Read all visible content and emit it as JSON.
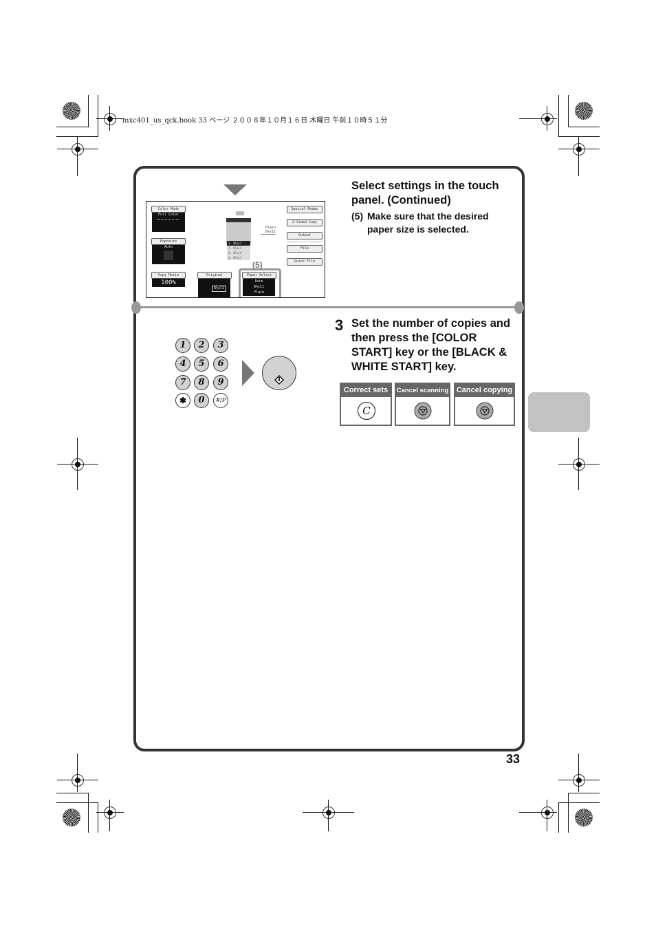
{
  "print_header": "mxc401_us_qck.book  33 ページ  ２００８年１０月１６日  木曜日  午前１０時５１分",
  "step_continued": {
    "heading": "Select settings in the touch panel. (Continued)",
    "substep_number": "(5)",
    "substep_text": "Make sure that the desired paper size is selected."
  },
  "touch_panel": {
    "color_mode": {
      "label": "Color Mode",
      "value": "Full Color"
    },
    "exposure": {
      "label": "Exposure",
      "value": "Auto"
    },
    "copy_ratio": {
      "label": "Copy Ratio",
      "value": "100%"
    },
    "original": {
      "label": "Original",
      "value": "8½x11"
    },
    "paper_select": {
      "label": "Paper Select",
      "values": [
        "Auto",
        "8½x11",
        "Plain"
      ],
      "callout": "(5)"
    },
    "output_tray": {
      "type": "Plain",
      "size": "8½x11"
    },
    "trays": [
      "1. 8½x11",
      "2. 8½x14",
      "3. 8½x14",
      "4. 8½x11"
    ],
    "right_buttons": [
      "Special Modes",
      "2-Sided Copy",
      "Output",
      "File",
      "Quick File"
    ]
  },
  "step3": {
    "number": "3",
    "text": "Set the number of copies and then press the [COLOR START] key or the [BLACK & WHITE START] key."
  },
  "keypad": {
    "keys": [
      "1",
      "2",
      "3",
      "4",
      "5",
      "6",
      "7",
      "8",
      "9",
      "✱",
      "0",
      "#/P"
    ]
  },
  "action_cards": [
    {
      "label": "Correct sets",
      "icon": "clear-key-icon",
      "glyph": "C"
    },
    {
      "label": "Cancel scanning",
      "icon": "stop-key-icon"
    },
    {
      "label": "Cancel copying",
      "icon": "stop-key-icon"
    }
  ],
  "page_number": "33"
}
